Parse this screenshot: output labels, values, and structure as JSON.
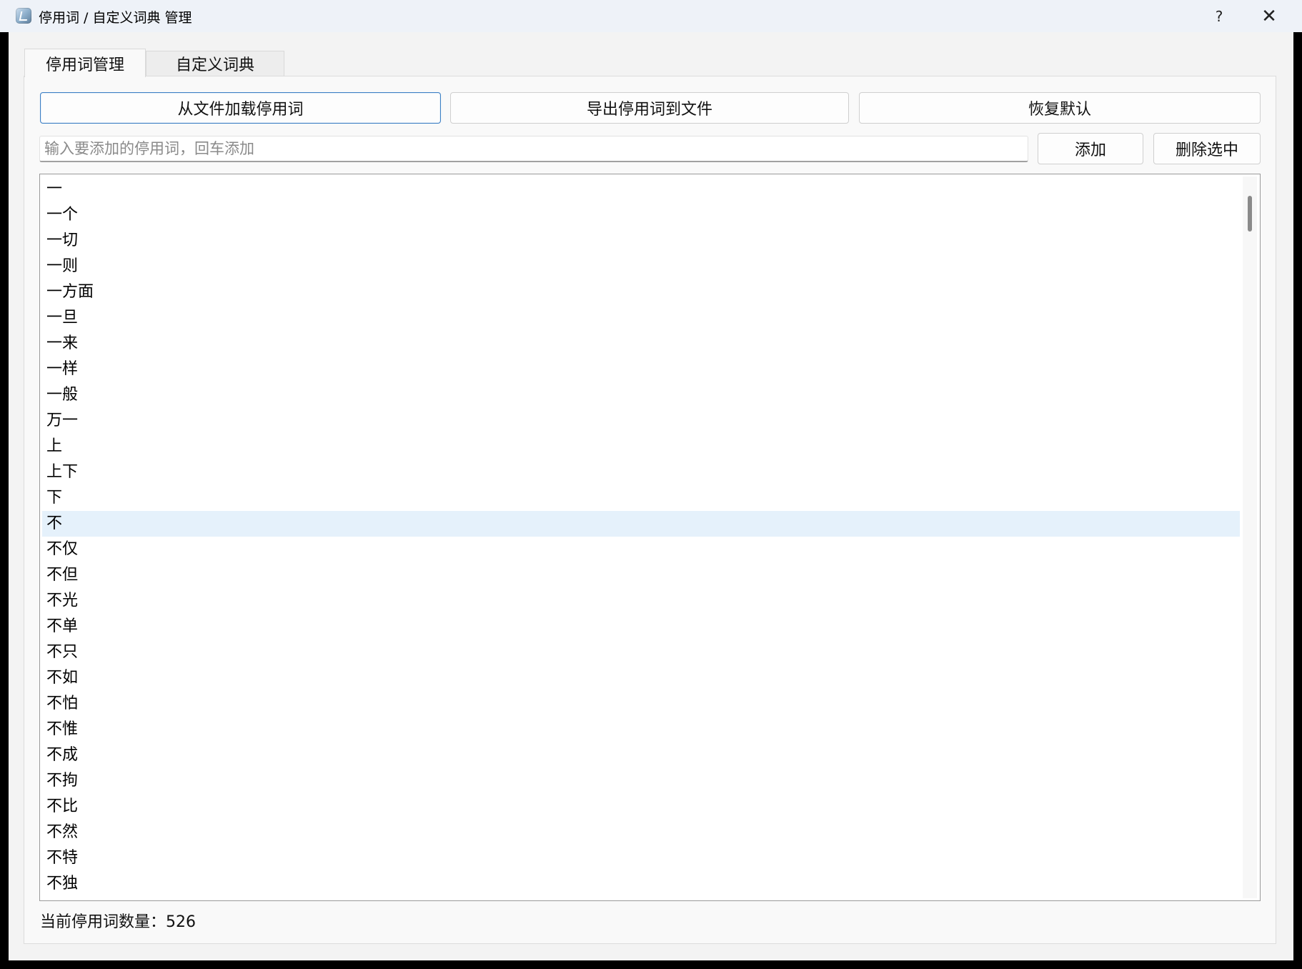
{
  "window": {
    "title": "停用词 / 自定义词典 管理",
    "help_label": "?",
    "close_label": "✕"
  },
  "tabs": [
    {
      "label": "停用词管理",
      "active": true
    },
    {
      "label": "自定义词典",
      "active": false
    }
  ],
  "toolbar": {
    "load_label": "从文件加载停用词",
    "export_label": "导出停用词到文件",
    "reset_label": "恢复默认"
  },
  "entry": {
    "value": "",
    "placeholder": "输入要添加的停用词，回车添加",
    "add_label": "添加",
    "delete_label": "删除选中"
  },
  "stopwords": {
    "items": [
      "一",
      "一个",
      "一切",
      "一则",
      "一方面",
      "一旦",
      "一来",
      "一样",
      "一般",
      "万一",
      "上",
      "上下",
      "下",
      "不",
      "不仅",
      "不但",
      "不光",
      "不单",
      "不只",
      "不如",
      "不怕",
      "不惟",
      "不成",
      "不拘",
      "不比",
      "不然",
      "不特",
      "不独"
    ],
    "selected": "不"
  },
  "status": {
    "text": "当前停用词数量：526"
  },
  "colors": {
    "selection": "#e5f1fb",
    "focus_border": "#3b7fc4",
    "titlebar": "#eef2f8"
  }
}
